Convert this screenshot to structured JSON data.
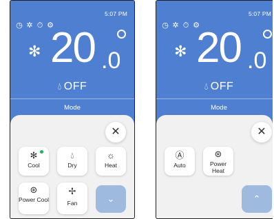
{
  "colors": {
    "screen_blue": "#4f7fd1",
    "panel_bg": "#f1f1f1",
    "active_dot": "#1fb45a",
    "chevron_btn": "#9fbadf"
  },
  "left": {
    "time": "5:07 PM",
    "temperature_int": "20",
    "temperature_dec": ".0",
    "power_text": "OFF",
    "mode_label": "Mode",
    "buttons": [
      {
        "label": "Cool",
        "icon": "snowflake-icon",
        "active": true
      },
      {
        "label": "Dry",
        "icon": "droplet-icon"
      },
      {
        "label": "Heat",
        "icon": "sun-icon"
      },
      {
        "label": "Power Cool",
        "icon": "power-cool-icon"
      },
      {
        "label": "Fan",
        "icon": "fan-icon"
      }
    ],
    "more_icon": "chevron-down-icon"
  },
  "right": {
    "time": "5:07 PM",
    "temperature_int": "20",
    "temperature_dec": ".0",
    "power_text": "OFF",
    "mode_label": "Mode",
    "buttons": [
      {
        "label": "Auto",
        "icon": "auto-icon"
      },
      {
        "label": "Power Heat",
        "icon": "power-heat-icon"
      }
    ],
    "less_icon": "chevron-up-icon"
  }
}
